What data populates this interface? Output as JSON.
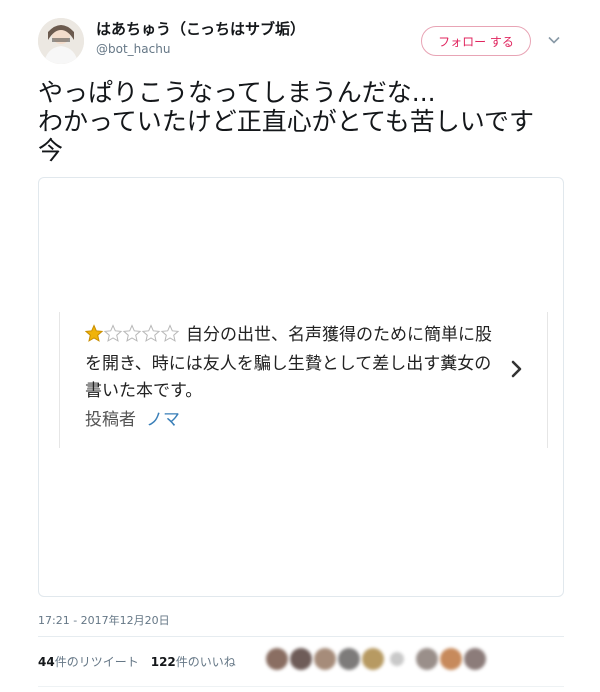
{
  "user": {
    "display_name": "はあちゅう（こっちはサブ垢）",
    "handle": "@bot_hachu"
  },
  "follow_button": {
    "label": "フォロー する"
  },
  "tweet": {
    "text": "やっぱりこうなってしまうんだな...\nわかっていたけど正直心がとても苦しいです\n今"
  },
  "review_card": {
    "rating": 1,
    "rating_max": 5,
    "star_color": "#f0b30a",
    "body": "自分の出世、名声獲得のために簡単に股を開き、時には友人を騙し生贄として差し出す糞女の書いた本です。",
    "author_label": "投稿者",
    "author_name": "ノマ"
  },
  "meta": {
    "timestamp": "17:21 - 2017年12月20日",
    "retweet_count": "44",
    "retweet_label": "件のリツイート",
    "like_count": "122",
    "like_label": "件のいいね"
  },
  "colors": {
    "follow_accent": "#e0245e",
    "link": "#3a7fb8",
    "muted": "#657786"
  }
}
